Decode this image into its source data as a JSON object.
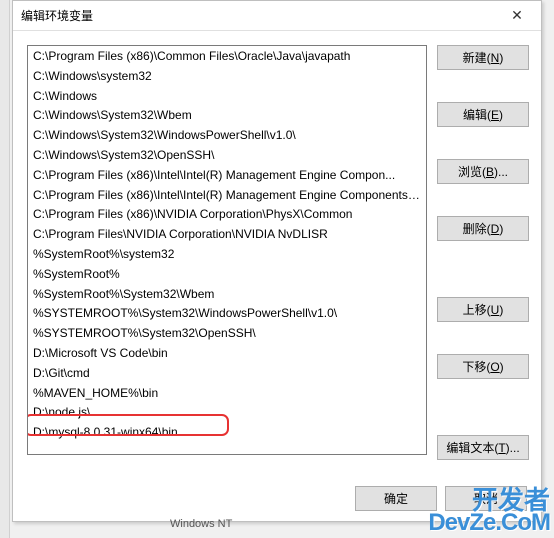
{
  "dialog": {
    "title": "编辑环境变量",
    "items": [
      "C:\\Program Files (x86)\\Common Files\\Oracle\\Java\\javapath",
      "C:\\Windows\\system32",
      "C:\\Windows",
      "C:\\Windows\\System32\\Wbem",
      "C:\\Windows\\System32\\WindowsPowerShell\\v1.0\\",
      "C:\\Windows\\System32\\OpenSSH\\",
      "C:\\Program Files (x86)\\Intel\\Intel(R) Management Engine Compon...",
      "C:\\Program Files (x86)\\Intel\\Intel(R) Management Engine Components\\...",
      "C:\\Program Files (x86)\\NVIDIA Corporation\\PhysX\\Common",
      "C:\\Program Files\\NVIDIA Corporation\\NVIDIA NvDLISR",
      "%SystemRoot%\\system32",
      "%SystemRoot%",
      "%SystemRoot%\\System32\\Wbem",
      "%SYSTEMROOT%\\System32\\WindowsPowerShell\\v1.0\\",
      "%SYSTEMROOT%\\System32\\OpenSSH\\",
      "D:\\Microsoft VS Code\\bin",
      "D:\\Git\\cmd",
      "%MAVEN_HOME%\\bin",
      "D:\\node.js\\",
      "D:\\mysql-8.0.31-winx64\\bin"
    ],
    "highlighted_index": 19,
    "buttons": {
      "new": "新建(N)",
      "edit": "编辑(E)",
      "browse": "浏览(B)...",
      "delete": "删除(D)",
      "moveup": "上移(U)",
      "movedown": "下移(O)",
      "edittext": "编辑文本(T)...",
      "ok": "确定",
      "cancel": "取消"
    }
  },
  "background": {
    "fragment": "Windows NT"
  },
  "watermark": {
    "line1": "开发者",
    "line2": "DevZe.CoM"
  }
}
